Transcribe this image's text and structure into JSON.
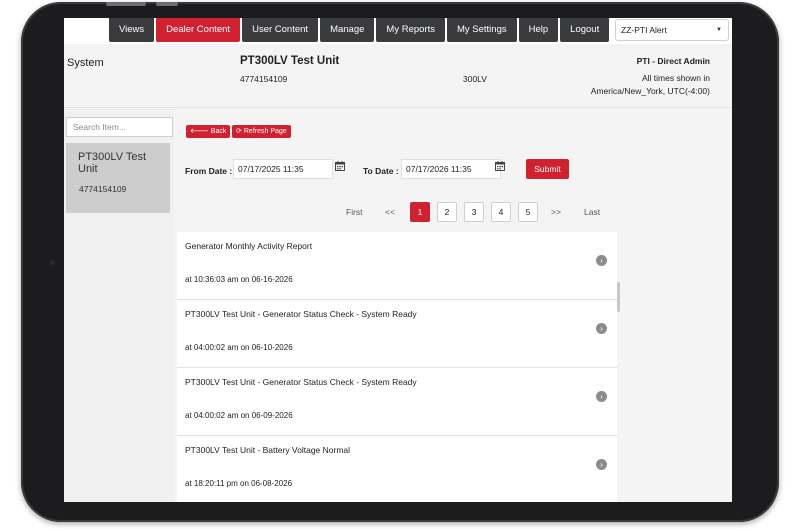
{
  "nav": {
    "items": [
      {
        "label": "Views",
        "active": false
      },
      {
        "label": "Dealer Content",
        "active": true
      },
      {
        "label": "User Content",
        "active": false
      },
      {
        "label": "Manage",
        "active": false
      },
      {
        "label": "My Reports",
        "active": false
      },
      {
        "label": "My Settings",
        "active": false
      },
      {
        "label": "Help",
        "active": false
      },
      {
        "label": "Logout",
        "active": false
      }
    ],
    "alert_select": {
      "value": "ZZ-PTI Alert",
      "icon": "caret-down-icon"
    }
  },
  "header": {
    "section": "System",
    "unit_title": "PT300LV Test Unit",
    "unit_serial": "4774154109",
    "unit_model": "300LV",
    "user_role": "PTI - Direct Admin",
    "timezone_note": "All times shown in America/New_York, UTC(-4:00)"
  },
  "sidebar": {
    "search": {
      "placeholder": "Search Item...",
      "value": ""
    },
    "items": [
      {
        "name": "PT300LV Test Unit",
        "serial": "4774154109",
        "selected": true
      }
    ]
  },
  "toolbar": {
    "back_label": "Back",
    "back_icon": "arrow-left-icon",
    "refresh_label": "Refresh Page",
    "refresh_icon": "refresh-icon"
  },
  "filters": {
    "from_label": "From Date :",
    "from_value": "07/17/2025 11:35",
    "to_label": "To Date :",
    "to_value": "07/17/2026 11:35",
    "submit_label": "Submit",
    "calendar_icon": "calendar-icon"
  },
  "pagination": {
    "first": "First",
    "prev": "<<",
    "pages": [
      "1",
      "2",
      "3",
      "4",
      "5"
    ],
    "current": "1",
    "next": ">>",
    "last": "Last"
  },
  "reports": [
    {
      "title": "Generator Monthly Activity Report",
      "time": "at 10:36:03 am on 06-16-2026"
    },
    {
      "title": "PT300LV Test Unit - Generator Status Check - System Ready",
      "time": "at 04:00:02 am on 06-10-2026"
    },
    {
      "title": "PT300LV Test Unit - Generator Status Check - System Ready",
      "time": "at 04:00:02 am on 06-09-2026"
    },
    {
      "title": "PT300LV Test Unit - Battery Voltage Normal",
      "time": "at 18:20:11 pm on 06-08-2026"
    }
  ],
  "colors": {
    "accent": "#d1202f",
    "nav_dark": "#3a3b3d"
  }
}
